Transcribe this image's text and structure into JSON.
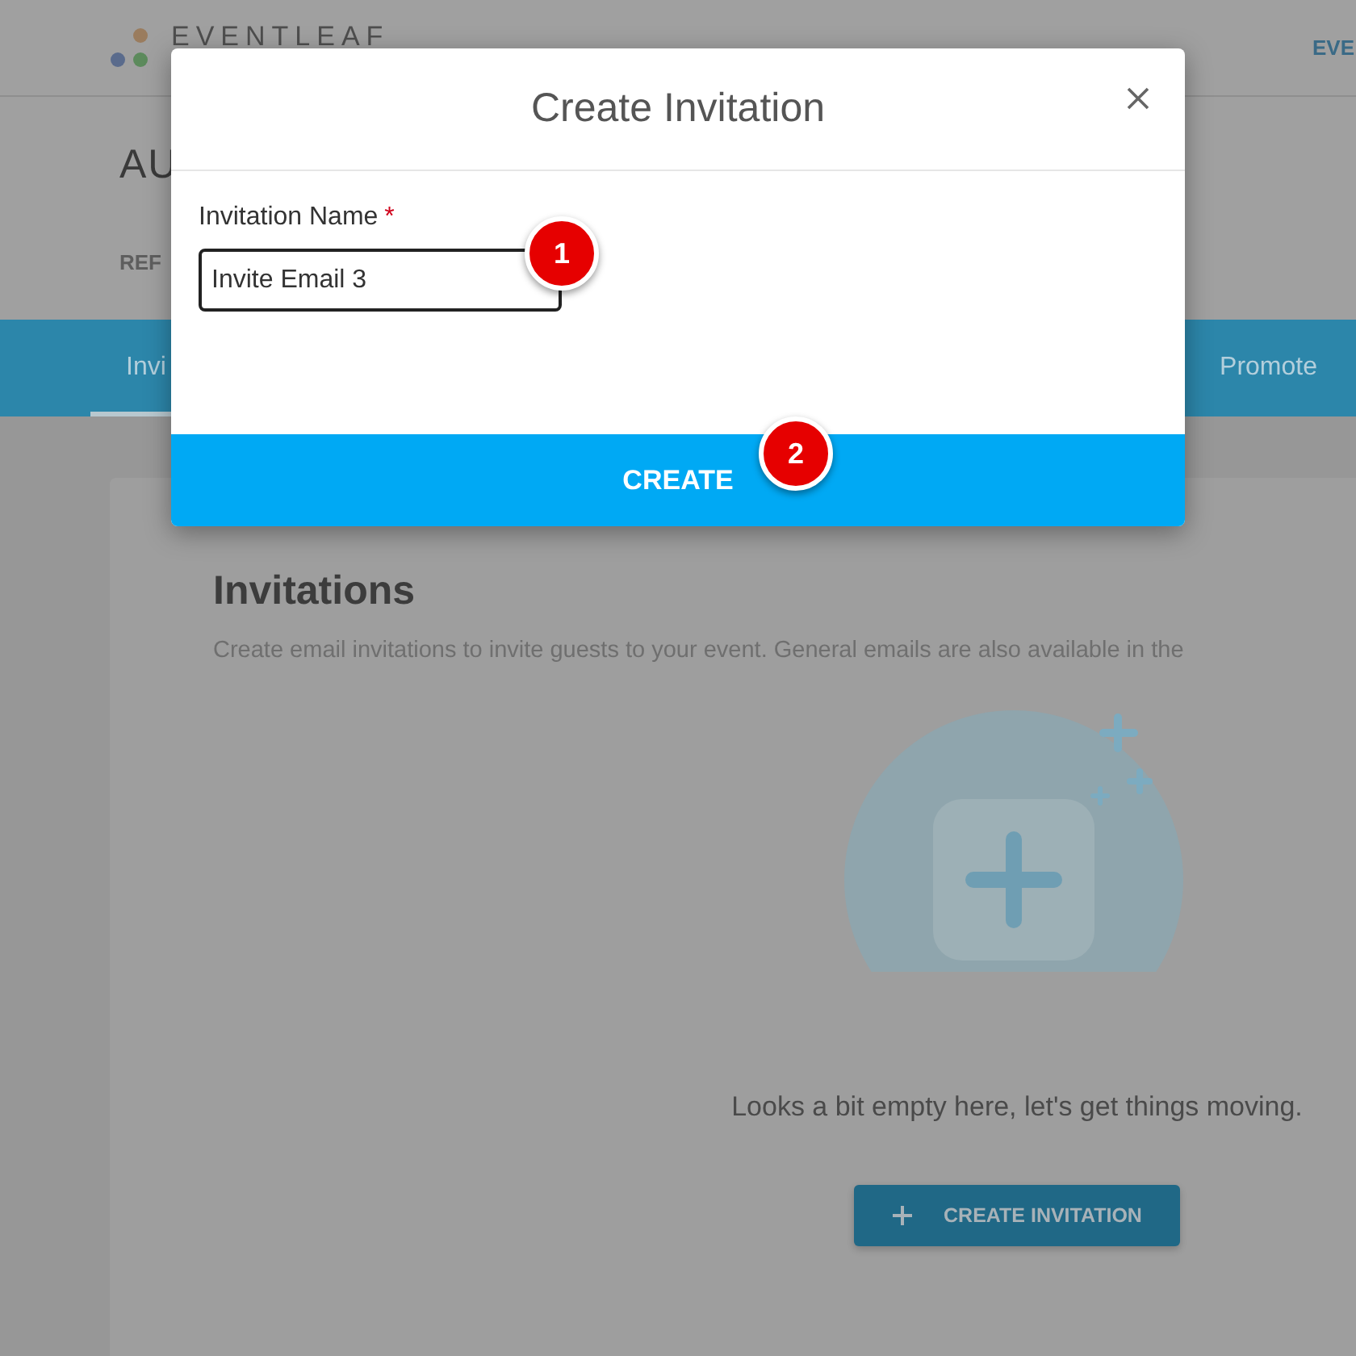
{
  "header": {
    "logo_text": "EVENTLEAF",
    "nav_link": "EVE"
  },
  "event": {
    "title": "AU",
    "tabs": [
      "REF"
    ]
  },
  "nav_tabs": [
    {
      "label": "Invi",
      "selected": true
    },
    {
      "label": "Promote",
      "selected": false
    }
  ],
  "page": {
    "heading": "Invitations",
    "description": "Create email invitations to invite guests to your event. General emails are also available in the",
    "empty_message": "Looks a bit empty here, let's get things moving.",
    "create_button": "CREATE INVITATION"
  },
  "modal": {
    "title": "Create Invitation",
    "field": {
      "label": "Invitation Name",
      "required_mark": "*",
      "value": "Invite Email 3"
    },
    "submit": "CREATE"
  },
  "callouts": [
    "1",
    "2"
  ]
}
